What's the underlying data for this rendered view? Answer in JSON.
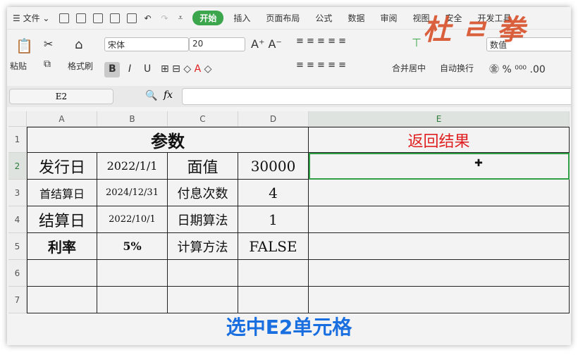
{
  "menu": {
    "file": "文件",
    "tabs": [
      "开始",
      "插入",
      "页面布局",
      "公式",
      "数据",
      "审阅",
      "视图",
      "安全",
      "开发工具"
    ]
  },
  "ribbon": {
    "paste": "粘贴",
    "format_painter": "格式刷",
    "font": "宋体",
    "size": "20",
    "merge": "合并居中",
    "wrap": "自动换行",
    "number_format": "数值"
  },
  "formula_bar": {
    "name_box": "E2",
    "fx": "fx",
    "value": ""
  },
  "columns": [
    "A",
    "B",
    "C",
    "D",
    "E"
  ],
  "rows": [
    "1",
    "2",
    "3",
    "4",
    "5",
    "6",
    "7"
  ],
  "sheet": {
    "title": "参数",
    "result": "返回结果",
    "r2": [
      "发行日",
      "2022/1/1",
      "面值",
      "30000"
    ],
    "r3": [
      "首结算日",
      "2024/12/31",
      "付息次数",
      "4"
    ],
    "r4": [
      "结算日",
      "2022/10/1",
      "日期算法",
      "1"
    ],
    "r5": [
      "利率",
      "5%",
      "计算方法",
      "FALSE"
    ]
  },
  "caption": "选中E2单元格",
  "watermark": "杜 さ 拳",
  "colors": {
    "accent": "#3ba64c",
    "result": "#e02020",
    "caption": "#1a6fe0"
  }
}
